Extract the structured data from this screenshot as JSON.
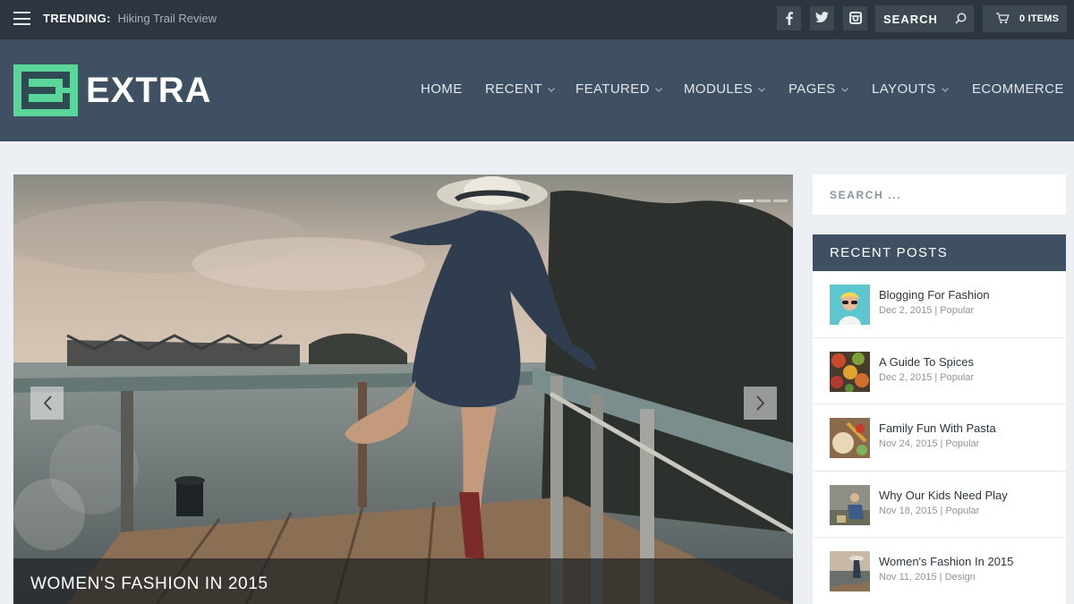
{
  "topbar": {
    "trending_label": "TRENDING:",
    "trending_link": "Hiking Trail Review",
    "social": [
      "facebook-icon",
      "twitter-icon",
      "instagram-icon"
    ],
    "search_placeholder": "SEARCH",
    "cart_label": "0 ITEMS"
  },
  "header": {
    "logo_text": "EXTRA",
    "logo_color": "#5bd69a",
    "nav": [
      "HOME",
      "RECENT",
      "FEATURED",
      "MODULES",
      "PAGES",
      "LAYOUTS",
      "ECOMMERCE"
    ]
  },
  "slider": {
    "caption_title": "WOMEN'S FASHION IN 2015",
    "slide_count": 3,
    "active_slide": 1
  },
  "sidebar": {
    "search_placeholder": "SEARCH ...",
    "recent_title": "RECENT POSTS",
    "posts": [
      {
        "title": "Blogging For Fashion",
        "meta": "Dec 2, 2015 | Popular"
      },
      {
        "title": "A Guide To Spices",
        "meta": "Dec 2, 2015 | Popular"
      },
      {
        "title": "Family Fun With Pasta",
        "meta": "Nov 24, 2015 | Popular"
      },
      {
        "title": "Why Our Kids Need Play",
        "meta": "Nov 18, 2015 | Popular"
      },
      {
        "title": "Women's Fashion In 2015",
        "meta": "Nov 11, 2015 | Design"
      }
    ]
  },
  "colors": {
    "topbar": "#2d3640",
    "header": "#3e5062",
    "page_bg": "#eceff4"
  }
}
